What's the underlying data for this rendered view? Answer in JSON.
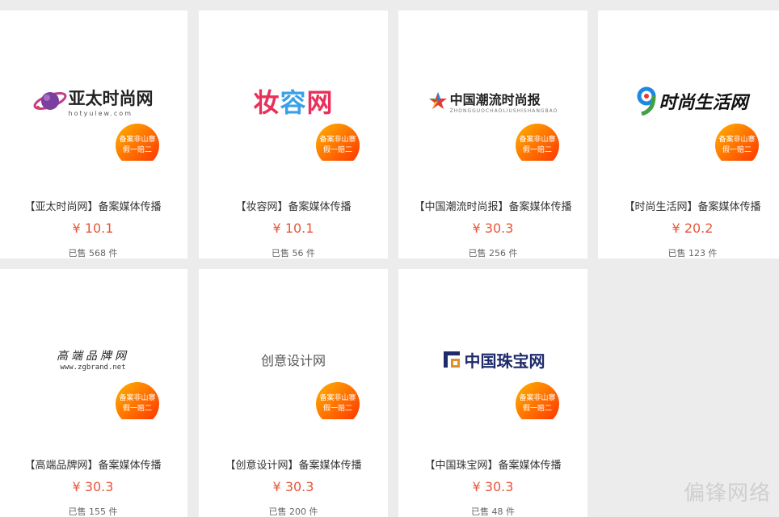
{
  "badge": {
    "line1": "备案非山寨",
    "line2": "假一赔二"
  },
  "currency": "¥",
  "products": [
    {
      "logo_text": "亚太时尚网",
      "logo_sub": "hotyulew.com",
      "title": "【亚太时尚网】备案媒体传播",
      "price": "¥ 10.1",
      "sold": "已售 568 件"
    },
    {
      "logo_text": "妆容网",
      "logo_sub": "",
      "title": "【妆容网】备案媒体传播",
      "price": "¥ 10.1",
      "sold": "已售 56 件"
    },
    {
      "logo_text": "中国潮流时尚报",
      "logo_sub": "ZHONGGUOCHAOLIUSHISHANGBAO",
      "title": "【中国潮流时尚报】备案媒体传播",
      "price": "¥ 30.3",
      "sold": "已售 256 件"
    },
    {
      "logo_text": "时尚生活网",
      "logo_sub": "",
      "title": "【时尚生活网】备案媒体传播",
      "price": "¥ 20.2",
      "sold": "已售 123 件"
    },
    {
      "logo_text": "高端品牌网",
      "logo_sub": "www.zgbrand.net",
      "title": "【高端品牌网】备案媒体传播",
      "price": "¥ 30.3",
      "sold": "已售 155 件"
    },
    {
      "logo_text": "创意设计网",
      "logo_sub": "",
      "title": "【创意设计网】备案媒体传播",
      "price": "¥ 30.3",
      "sold": "已售 200 件"
    },
    {
      "logo_text": "中国珠宝网",
      "logo_sub": "",
      "title": "【中国珠宝网】备案媒体传播",
      "price": "¥ 30.3",
      "sold": "已售 48 件"
    }
  ],
  "colors": {
    "price": "#e8563a",
    "badge_start": "#ffb300",
    "badge_end": "#ff2d00",
    "background": "#ececec"
  },
  "watermark": "偏锋网络"
}
